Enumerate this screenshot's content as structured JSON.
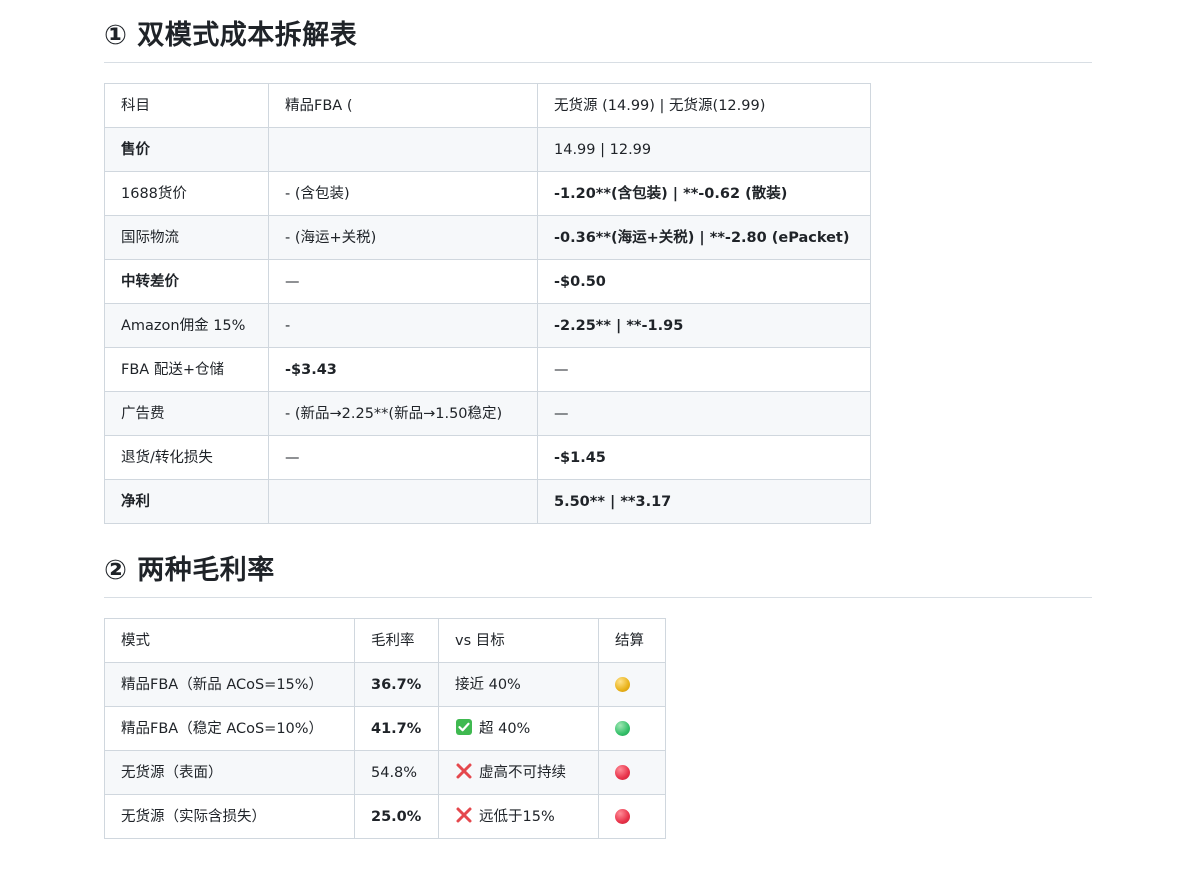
{
  "section1": {
    "title": "① 双模式成本拆解表",
    "rows": [
      [
        "科目",
        "精品FBA (",
        "无货源 (14.99) | 无货源(12.99)"
      ],
      [
        "售价",
        "",
        "14.99 | 12.99"
      ],
      [
        "1688货价",
        "- (含包装)",
        "-1.20**(含包装) | **-0.62 (散装)"
      ],
      [
        "国际物流",
        "- (海运+关税)",
        "-0.36**(海运+关税) | **-2.80 (ePacket)"
      ],
      [
        "中转差价",
        "—",
        "-$0.50"
      ],
      [
        "Amazon佣金 15%",
        "-",
        "-2.25** | **-1.95"
      ],
      [
        "FBA 配送+仓储",
        "-$3.43",
        "—"
      ],
      [
        "广告费",
        "- (新品→2.25**(新品→1.50稳定)",
        "—"
      ],
      [
        "退货/转化损失",
        "—",
        "-$1.45"
      ],
      [
        "净利",
        "",
        "5.50** | **3.17"
      ]
    ]
  },
  "section2": {
    "title": "② 两种毛利率",
    "header": [
      "模式",
      "毛利率",
      "vs 目标",
      "结算"
    ],
    "rows": [
      {
        "mode": "精品FBA（新品 ACoS=15%）",
        "margin": "36.7%",
        "vs": "接近 40%",
        "vs_icon": "",
        "status": "yellow"
      },
      {
        "mode": "精品FBA（稳定 ACoS=10%）",
        "margin": "41.7%",
        "vs": "超 40%",
        "vs_icon": "check-icon",
        "status": "green"
      },
      {
        "mode": "无货源（表面）",
        "margin": "54.8%",
        "vs": "虚高不可持续",
        "vs_icon": "cross-icon",
        "status": "red"
      },
      {
        "mode": "无货源（实际含损失）",
        "margin": "25.0%",
        "vs": "远低于15%",
        "vs_icon": "cross-icon",
        "status": "red"
      }
    ]
  },
  "colors": {
    "header_border": "#d8dee4",
    "cell_border": "#d0d7de",
    "row_alt": "#f6f8fa",
    "check": "#3fb950",
    "cross": "#e5484d"
  }
}
